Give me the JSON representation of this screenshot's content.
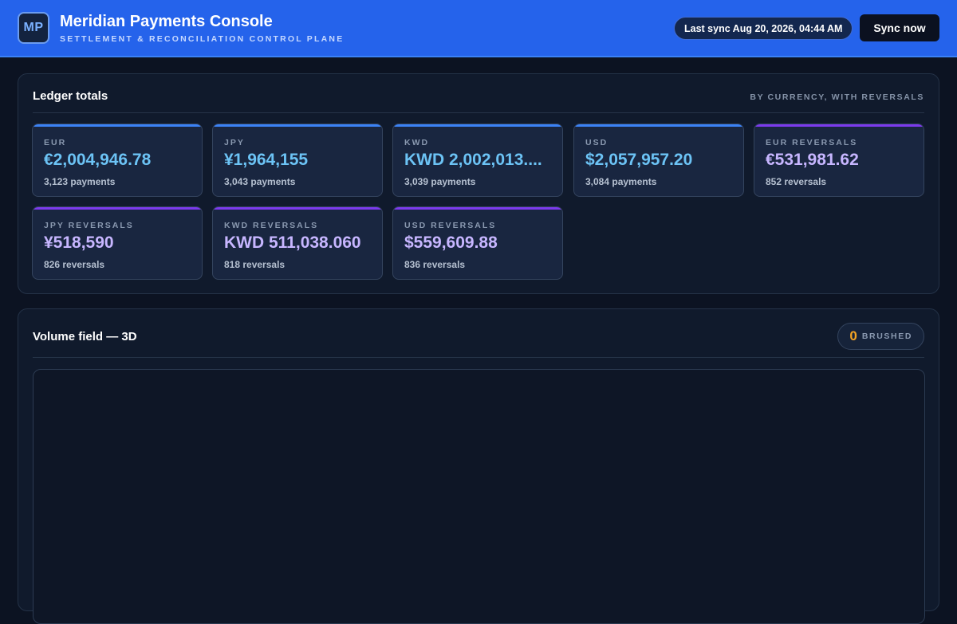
{
  "header": {
    "logo": "MP",
    "title": "Meridian Payments Console",
    "subtitle": "SETTLEMENT & RECONCILIATION CONTROL PLANE",
    "last_sync": "Last sync Aug 20, 2026, 04:44 AM",
    "sync_button": "Sync now"
  },
  "ledger": {
    "title": "Ledger totals",
    "meta": "BY CURRENCY, WITH REVERSALS",
    "cards": [
      {
        "label": "EUR",
        "value": "€2,004,946.78",
        "count": "3,123 payments",
        "kind": "payment"
      },
      {
        "label": "JPY",
        "value": "¥1,964,155",
        "count": "3,043 payments",
        "kind": "payment"
      },
      {
        "label": "KWD",
        "value": "KWD 2,002,013....",
        "count": "3,039 payments",
        "kind": "payment"
      },
      {
        "label": "USD",
        "value": "$2,057,957.20",
        "count": "3,084 payments",
        "kind": "payment"
      },
      {
        "label": "EUR REVERSALS",
        "value": "€531,981.62",
        "count": "852 reversals",
        "kind": "reversal"
      },
      {
        "label": "JPY REVERSALS",
        "value": "¥518,590",
        "count": "826 reversals",
        "kind": "reversal"
      },
      {
        "label": "KWD REVERSALS",
        "value": "KWD 511,038.060",
        "count": "818 reversals",
        "kind": "reversal"
      },
      {
        "label": "USD REVERSALS",
        "value": "$559,609.88",
        "count": "836 reversals",
        "kind": "reversal"
      }
    ]
  },
  "volume": {
    "title": "Volume field — 3D",
    "brushed_count": "0",
    "brushed_label": "BRUSHED"
  },
  "colors": {
    "accent": "#2563eb",
    "payment_value": "#6cc3f5",
    "reversal_value": "#c7b6ff",
    "brushed_count": "#f5a524"
  }
}
